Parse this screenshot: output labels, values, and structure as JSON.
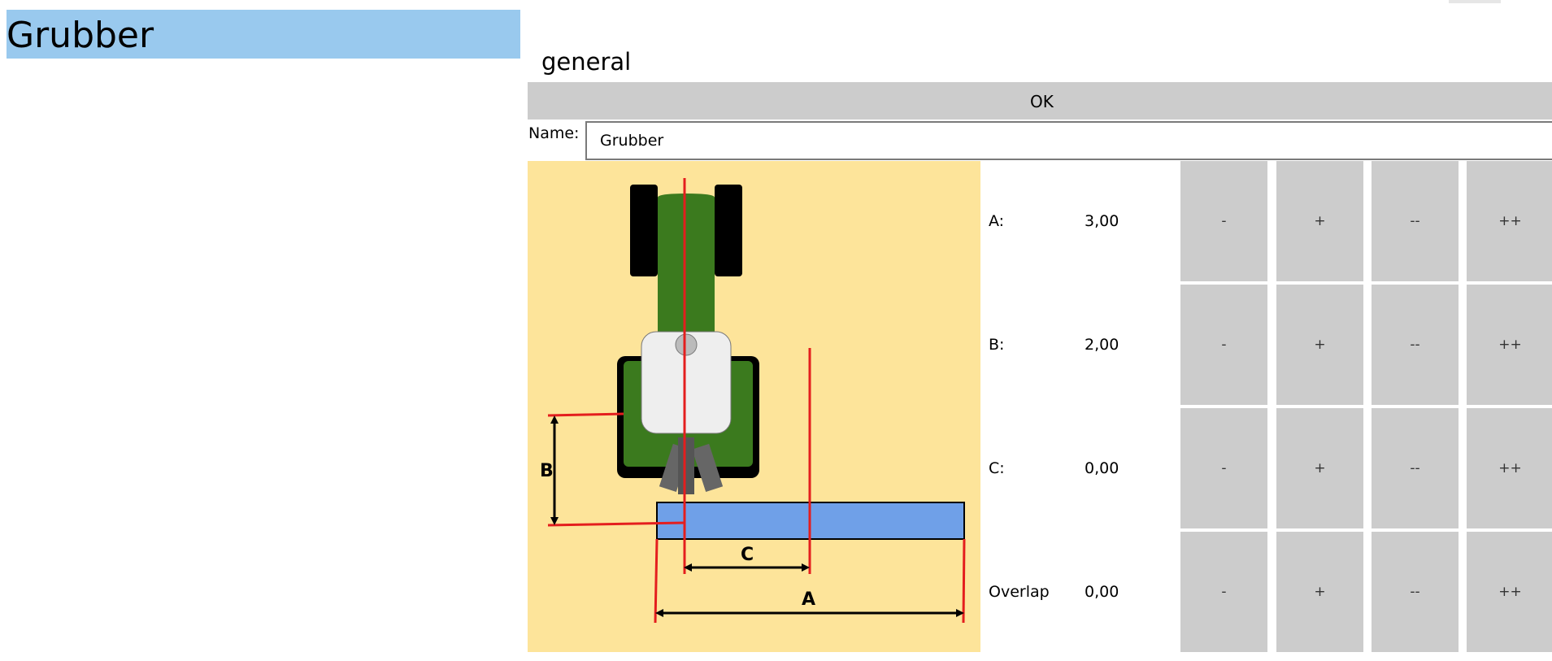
{
  "left_panel": {
    "title": "Grubber"
  },
  "section": {
    "title": "general"
  },
  "ok_label": "OK",
  "name": {
    "label": "Name:",
    "value": "Grubber"
  },
  "diagram": {
    "label_a": "A",
    "label_b": "B",
    "label_c": "C"
  },
  "step_labels": {
    "minus": "-",
    "plus": "+",
    "minus_big": "--",
    "plus_big": "++"
  },
  "params": [
    {
      "label": "A:",
      "value": "3,00"
    },
    {
      "label": "B:",
      "value": "2,00"
    },
    {
      "label": "C:",
      "value": "0,00"
    },
    {
      "label": "Overlap",
      "value": "0,00"
    }
  ],
  "colors": {
    "title_bg": "#99c9ee",
    "diagram_bg": "#fde49a",
    "button_bg": "#cccccc",
    "tractor_green": "#3b7a1e",
    "implement_blue": "#6fa0e8",
    "guide_red": "#e41e1e"
  }
}
